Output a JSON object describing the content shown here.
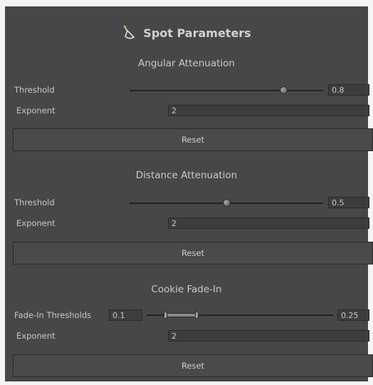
{
  "title": "Spot Parameters",
  "title_icon": "spotlight-icon",
  "angular": {
    "header": "Angular Attenuation",
    "threshold_label": "Threshold",
    "threshold_value": "0.8",
    "threshold_slider_level": 0.8,
    "exponent_label": "Exponent",
    "exponent_value": "2",
    "reset_label": "Reset"
  },
  "distance": {
    "header": "Distance Attenuation",
    "threshold_label": "Threshold",
    "threshold_value": "0.5",
    "threshold_slider_level": 0.5,
    "exponent_label": "Exponent",
    "exponent_value": "2",
    "reset_label": "Reset"
  },
  "cookie": {
    "header": "Cookie Fade-In",
    "thresholds_label": "Fade-In Thresholds",
    "min_value": "0.1",
    "max_value": "0.25",
    "exponent_label": "Exponent",
    "exponent_value": "2",
    "reset_label": "Reset"
  },
  "colors": {
    "panel_background": "#474747",
    "field_background": "#3d3d3d",
    "text": "#c8c8c8"
  }
}
